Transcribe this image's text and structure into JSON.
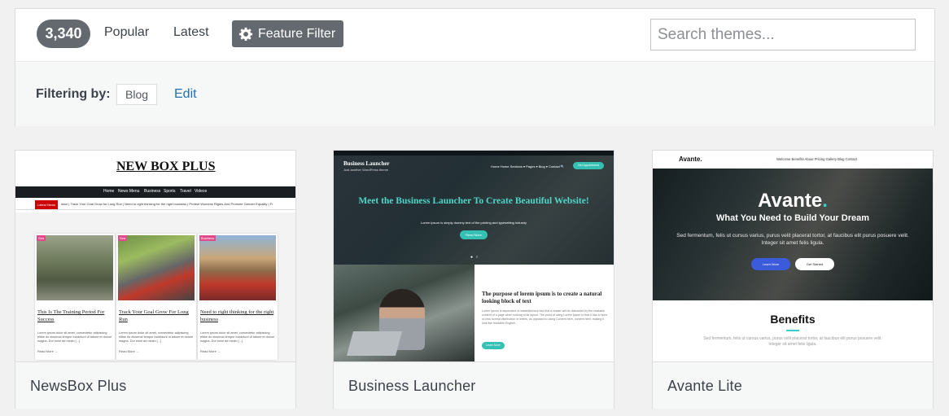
{
  "filters": {
    "count": "3,340",
    "popular_label": "Popular",
    "latest_label": "Latest",
    "feature_filter_label": "Feature Filter",
    "search_placeholder": "Search themes..."
  },
  "active_filter": {
    "label": "Filtering by:",
    "tag": "Blog",
    "edit_label": "Edit"
  },
  "themes": [
    {
      "name": "NewsBox Plus",
      "preview": {
        "logo": "NEW BOX PLUS",
        "nav": [
          "Home",
          "News Menu",
          "Business",
          "Sports",
          "Travel",
          "Videos"
        ],
        "latest_label": "Latest News",
        "ticker": "ision  |  Track Your Goal Grow for Long Run  |  Need to right thinking for the right business  |  Protect Womens Rights And Promote Gender Equality  |  Fr",
        "posts": [
          {
            "category": "Sea",
            "title": "This Is The Training Period For Success",
            "excerpt": "Lorem ipsum dolor sit amet, consectetur adipiscing elitse do eiusmod tempor incididunt ut labore et dolore magna. Dor enim ad minim [...]",
            "more": "Read More →"
          },
          {
            "category": "Sea",
            "title": "Track Your Goal Grow For Long Run",
            "excerpt": "Lorem ipsum dolor sit amet, consectetur adipiscing elitse do eiusmod tempor incididunt ut labore et dolore magna. Dor enim ad minim [...]",
            "more": "Read More →"
          },
          {
            "category": "Business",
            "title": "Need to right thinking for the right business",
            "excerpt": "Lorem ipsum dolor sit amet, consectetur adipiscing elitse do eiusmod tempor incididunt ut labore et dolore magna. Dor enim ad minim [...]",
            "more": "Read More →"
          }
        ]
      }
    },
    {
      "name": "Business Launcher",
      "preview": {
        "logo": "Business Launcher",
        "subtitle": "Just another WordPress theme",
        "menu": "Home   Home Sections ▾   Pages ▾   Blog ▾   Contact   🔍",
        "cta": "Get Appointment",
        "headline": "Meet the Business Launcher To Create Beautiful Website!",
        "hero_sub": "Lorem ipsum is simply dummy text of the printing and typesetting industry",
        "read_more": "Read More",
        "section_title": "The purpose of lorem ipsum is to create a natural looking block of text",
        "section_body": "Lorem ipsum is dependent of establishment fact that a reader will be distracted by the readable content of a page when looking at its layout. The point of using Lorem Ipsum is that it has a more-or-less normal distribution of letters, as opposed to using Content here, content here, making it look like readable English.",
        "section_btn": "Learn More"
      }
    },
    {
      "name": "Avante Lite",
      "preview": {
        "logo": "Avante.",
        "menu": "Welcome    Benefits    About    Pricing    Gallery    Blog    Contact",
        "hero_title": "Avante",
        "hero_dot": ".",
        "hero_tagline": "What You Need to Build Your Dream",
        "hero_desc": "Sed fermentum, felis ut cursus varius, purus velit placerat tortor, at faucibus elit purus posuere velit. Integer sit amet felis ligula.",
        "btn_primary": "Learn More",
        "btn_secondary": "Get Started",
        "benefits_title": "Benefits",
        "benefits_text": "Sed fermentum, felis ut cursus varius, purus velit placerat tortor, at faucibus elit purus posuere velit. Integer sit amet felis ligula."
      }
    }
  ],
  "colors": {
    "badge_bg": "#646970",
    "link_blue": "#2271b1",
    "teal_accent": "#35c0b4"
  }
}
